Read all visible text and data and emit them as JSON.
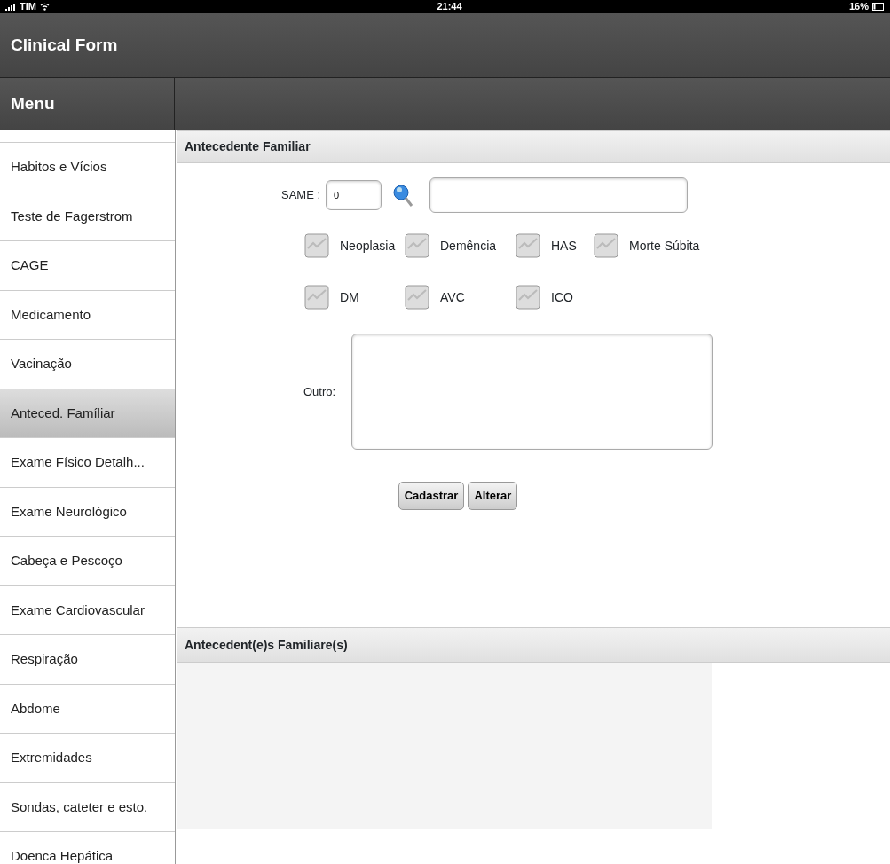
{
  "status_bar": {
    "carrier": "TIM",
    "time": "21:44",
    "battery": "16%"
  },
  "header": {
    "title": "Clinical Form"
  },
  "sidebar": {
    "title": "Menu",
    "items": [
      {
        "label": "Habitos e Vícios",
        "selected": false
      },
      {
        "label": "Teste de Fagerstrom",
        "selected": false
      },
      {
        "label": "CAGE",
        "selected": false
      },
      {
        "label": "Medicamento",
        "selected": false
      },
      {
        "label": "Vacinação",
        "selected": false
      },
      {
        "label": "Anteced. Famíliar",
        "selected": true
      },
      {
        "label": "Exame Físico Detalh...",
        "selected": false
      },
      {
        "label": "Exame Neurológico",
        "selected": false
      },
      {
        "label": "Cabeça e Pescoço",
        "selected": false
      },
      {
        "label": "Exame Cardiovascular",
        "selected": false
      },
      {
        "label": "Respiração",
        "selected": false
      },
      {
        "label": "Abdome",
        "selected": false
      },
      {
        "label": "Extremidades",
        "selected": false
      },
      {
        "label": "Sondas, cateter e esto.",
        "selected": false
      },
      {
        "label": "Doenca Hepática",
        "selected": false
      }
    ]
  },
  "form": {
    "title": "Antecedente Familiar",
    "same_label": "SAME :",
    "same_value": "0",
    "checkbox_rows": [
      [
        {
          "label": "Neoplasia",
          "checked": false
        },
        {
          "label": "Demência",
          "checked": false
        },
        {
          "label": "HAS",
          "checked": false
        },
        {
          "label": "Morte Súbita",
          "checked": false
        }
      ],
      [
        {
          "label": "DM",
          "checked": false
        },
        {
          "label": "AVC",
          "checked": false
        },
        {
          "label": "ICO",
          "checked": false
        }
      ]
    ],
    "other_label": "Outro:",
    "buttons": [
      "Cadastrar",
      "Alterar"
    ]
  },
  "list": {
    "title": "Antecedent(e)s Familiare(s)"
  }
}
